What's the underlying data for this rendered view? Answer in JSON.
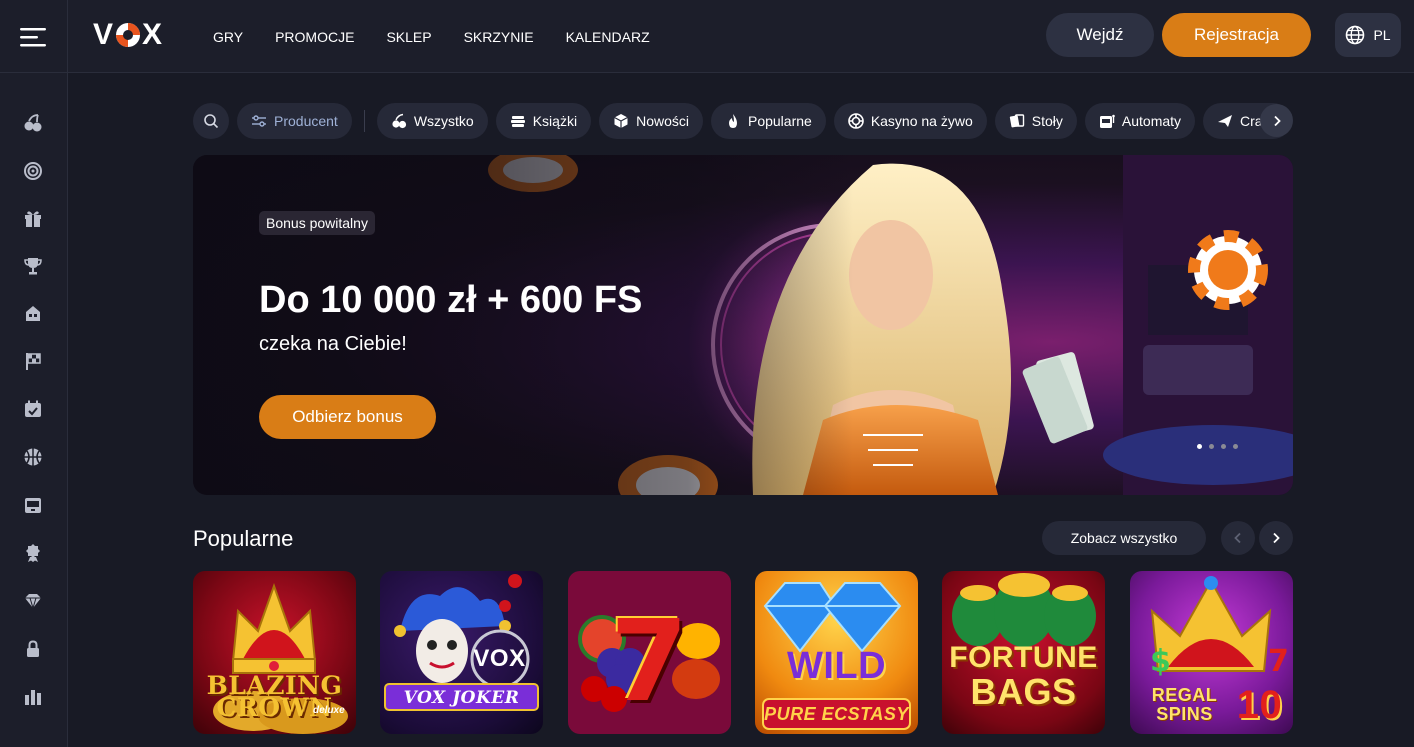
{
  "brand": {
    "logo_text_left": "V",
    "logo_text_right": "X",
    "accent": "#d97d16"
  },
  "nav": {
    "items": [
      "GRY",
      "PROMOCJE",
      "SKLEP",
      "SKRZYNIE",
      "KALENDARZ"
    ]
  },
  "header": {
    "login_label": "Wejdź",
    "register_label": "Rejestracja",
    "lang_label": "PL"
  },
  "sidebar": {
    "icons": [
      "cherries-icon",
      "roulette-icon",
      "gift-icon",
      "trophy-icon",
      "store-icon",
      "race-flag-icon",
      "calendar-icon",
      "sports-ball-icon",
      "slot-machine-icon",
      "award-icon",
      "diamond-icon",
      "lock-icon",
      "leaderboard-icon"
    ]
  },
  "filters": {
    "producer_label": "Producent",
    "categories": [
      "Wszystko",
      "Książki",
      "Nowości",
      "Popularne",
      "Kasyno na żywo",
      "Stoły",
      "Automaty",
      "Crash"
    ]
  },
  "banner": {
    "badge": "Bonus powitalny",
    "headline": "Do 10 000 zł + 600 FS",
    "subline": "czeka na Ciebie!",
    "cta_label": "Odbierz bonus",
    "slide_count": 4,
    "active_slide": 1
  },
  "popular": {
    "title": "Popularne",
    "see_all_label": "Zobacz wszystko",
    "games": [
      {
        "title_line1": "BLAZING",
        "title_line2": "CROWN",
        "tag": "deluxe"
      },
      {
        "title_line1": "VOX",
        "title_line2": "VOX JOKER",
        "tag": ""
      },
      {
        "title_line1": "7",
        "title_line2": "",
        "tag": ""
      },
      {
        "title_line1": "WILD",
        "title_line2": "PURE ECSTASY",
        "tag": ""
      },
      {
        "title_line1": "FORTUNE",
        "title_line2": "BAGS",
        "tag": ""
      },
      {
        "title_line1": "REGAL",
        "title_line2": "SPINS",
        "tag": "10"
      }
    ]
  }
}
